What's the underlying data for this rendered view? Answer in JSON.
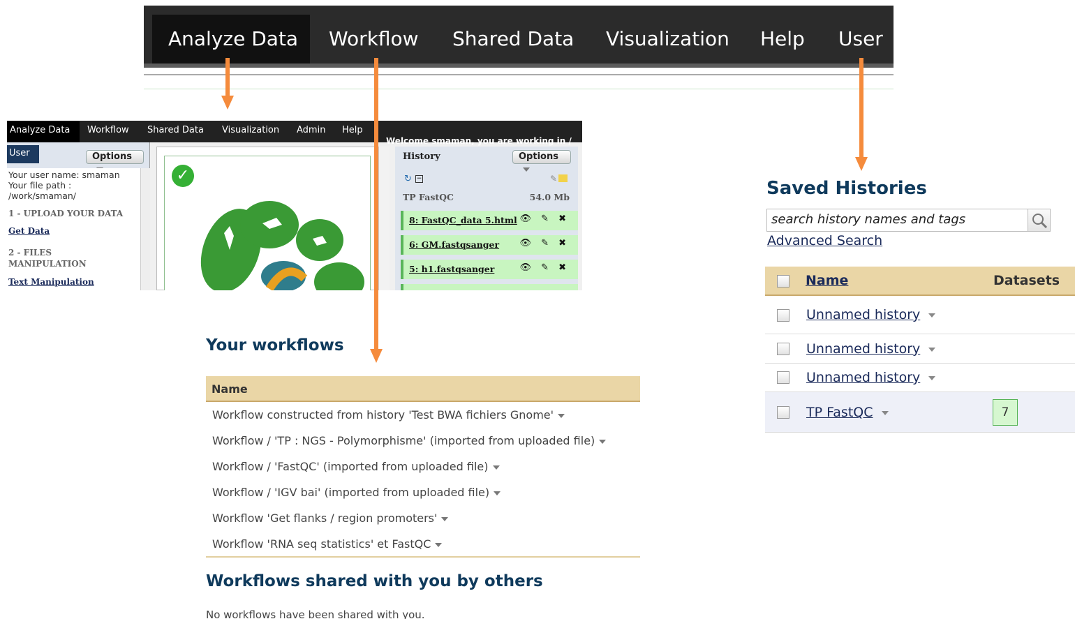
{
  "main_nav": {
    "tabs": [
      "Analyze Data",
      "Workflow",
      "Shared Data",
      "Visualization",
      "Help",
      "User"
    ],
    "active": "Analyze Data"
  },
  "galaxy_window": {
    "nav_tabs": [
      "Analyze Data",
      "Workflow",
      "Shared Data",
      "Visualization",
      "Admin",
      "Help"
    ],
    "welcome_text": "Welcome smaman, you are working in /",
    "user_label": "User",
    "left_options_label": "Options",
    "user_name_text": "Your user name: smaman",
    "file_path_label": "Your file path :",
    "file_path_value": "/work/smaman/",
    "section1": "1 - UPLOAD YOUR DATA",
    "section1_link": "Get Data",
    "section2_line1": "2 - FILES",
    "section2_line2": "MANIPULATION",
    "section2_link": "Text Manipulation",
    "history_title": "History",
    "history_options_label": "Options",
    "history_name": "TP FastQC",
    "history_size": "54.0 Mb",
    "datasets": [
      {
        "name": "8: FastQC_data 5.html"
      },
      {
        "name": "6: GM.fastqsanger"
      },
      {
        "name": "5: h1.fastqsanger"
      }
    ],
    "dataset_icons": "👁 ✎ ✖"
  },
  "workflows": {
    "title": "Your workflows",
    "column_name": "Name",
    "rows": [
      "Workflow constructed from history 'Test BWA fichiers Gnome'",
      "Workflow / 'TP : NGS - Polymorphisme' (imported from uploaded file)",
      "Workflow / 'FastQC' (imported from uploaded file)",
      "Workflow / 'IGV bai' (imported from uploaded file)",
      "Workflow 'Get flanks / region promoters'",
      "Workflow 'RNA seq statistics' et FastQC"
    ],
    "shared_title": "Workflows shared with you by others",
    "shared_empty": "No workflows have been shared with you."
  },
  "saved_histories": {
    "title": "Saved Histories",
    "search_placeholder": "search history names and tags",
    "advanced_search": "Advanced Search",
    "col_name": "Name",
    "col_datasets": "Datasets",
    "rows": [
      {
        "name": "Unnamed history",
        "datasets": ""
      },
      {
        "name": "Unnamed history",
        "datasets": ""
      },
      {
        "name": "Unnamed history",
        "datasets": ""
      },
      {
        "name": "TP FastQC",
        "datasets": "7"
      }
    ]
  },
  "colors": {
    "arrow": "#f58b3c",
    "heading": "#0f3a5c",
    "table_header": "#ead6a6",
    "nav_bg": "#2b2b2b"
  }
}
